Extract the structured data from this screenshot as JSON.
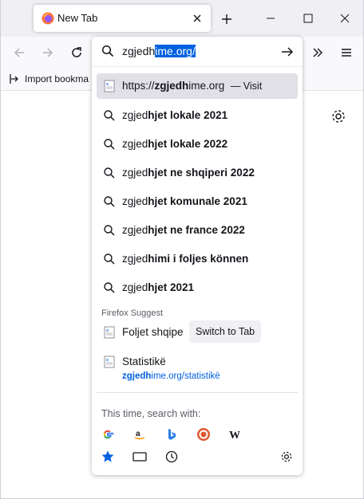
{
  "tab": {
    "title": "New Tab"
  },
  "bookmarks": {
    "import_label": "Import bookma"
  },
  "urlbar": {
    "typed": "zgjedh",
    "autofill_selected": "ime.org/"
  },
  "visit_result": {
    "prefix": "https://",
    "bold": "zgjedh",
    "rest": "ime.org",
    "action": "— Visit"
  },
  "suggestions": [
    {
      "typed": "zgjed",
      "completion": "hjet lokale 2021"
    },
    {
      "typed": "zgjed",
      "completion": "hjet lokale 2022"
    },
    {
      "typed": "zgjed",
      "completion": "hjet ne shqiperi 2022"
    },
    {
      "typed": "zgjed",
      "completion": "hjet komunale 2021"
    },
    {
      "typed": "zgjed",
      "completion": "hjet ne france 2022"
    },
    {
      "typed": "zgjed",
      "completion": "himi i foljes können"
    },
    {
      "typed": "zgjed",
      "completion": "hjet 2021"
    }
  ],
  "firefox_suggest": {
    "label": "Firefox Suggest",
    "tab_result": {
      "title": "Foljet shqipe",
      "action": "Switch to Tab"
    },
    "history_result": {
      "title": "Statistikë",
      "url_bold": "zgjedh",
      "url_rest": "ime.org/statistikë"
    }
  },
  "search_with": {
    "label": "This time, search with:",
    "engines": [
      "google-icon",
      "amazon-icon",
      "bing-icon",
      "duckduckgo-icon",
      "wikipedia-icon"
    ],
    "modes": [
      "bookmarks-star-icon",
      "tabs-icon",
      "history-clock-icon"
    ]
  },
  "colors": {
    "accent": "#0061e0",
    "selected_row": "#e0e0e6",
    "chrome": "#f0f0f4"
  }
}
